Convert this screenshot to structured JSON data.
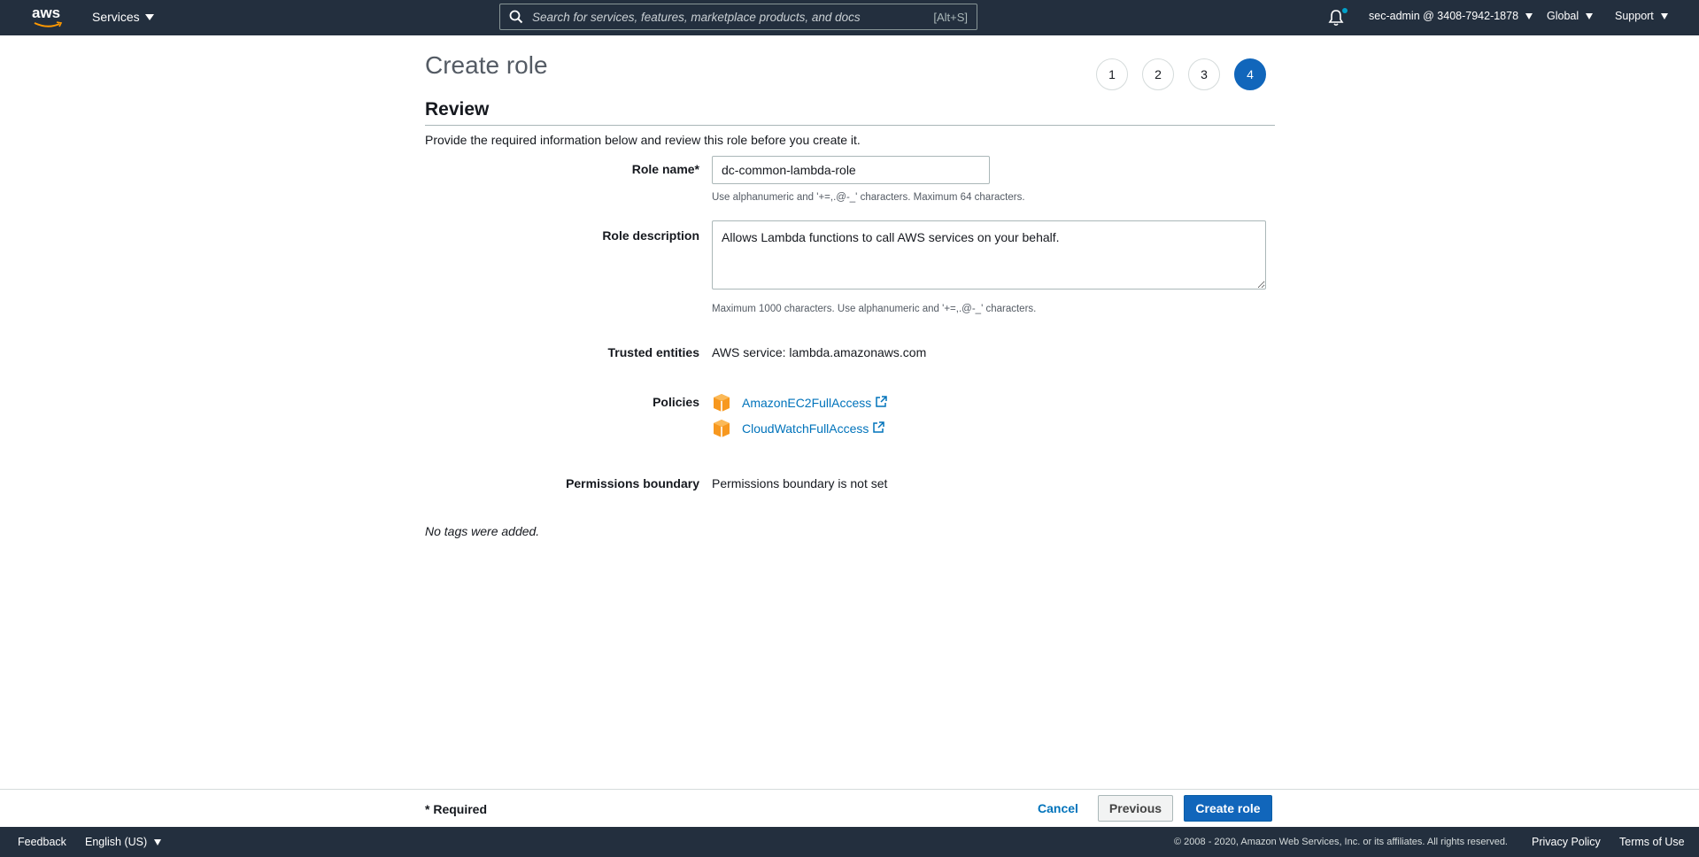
{
  "topnav": {
    "logo_text": "aws",
    "services_label": "Services",
    "search_placeholder": "Search for services, features, marketplace products, and docs",
    "search_shortcut": "[Alt+S]",
    "account_label": "sec-admin @ 3408-7942-1878",
    "region_label": "Global",
    "support_label": "Support"
  },
  "page": {
    "title": "Create role",
    "steps": [
      "1",
      "2",
      "3",
      "4"
    ],
    "active_step": 4,
    "section_title": "Review",
    "intro": "Provide the required information below and review this role before you create it."
  },
  "form": {
    "role_name_label": "Role name*",
    "role_name_value": "dc-common-lambda-role",
    "role_name_hint": "Use alphanumeric and '+=,.@-_' characters. Maximum 64 characters.",
    "role_desc_label": "Role description",
    "role_desc_value": "Allows Lambda functions to call AWS services on your behalf.",
    "role_desc_hint": "Maximum 1000 characters. Use alphanumeric and '+=,.@-_' characters.",
    "trusted_label": "Trusted entities",
    "trusted_value": "AWS service: lambda.amazonaws.com",
    "policies_label": "Policies",
    "policies": [
      "AmazonEC2FullAccess",
      "CloudWatchFullAccess"
    ],
    "boundary_label": "Permissions boundary",
    "boundary_value": "Permissions boundary is not set",
    "no_tags": "No tags were added."
  },
  "actions": {
    "required_note": "* Required",
    "cancel": "Cancel",
    "previous": "Previous",
    "create": "Create role"
  },
  "bottombar": {
    "feedback": "Feedback",
    "language": "English (US)",
    "copyright": "© 2008 - 2020, Amazon Web Services, Inc. or its affiliates. All rights reserved.",
    "privacy": "Privacy Policy",
    "terms": "Terms of Use"
  },
  "colors": {
    "nav_bg": "#232f3e",
    "primary": "#1166bb",
    "link": "#0073bb",
    "policy_icon": "#f7981f"
  }
}
